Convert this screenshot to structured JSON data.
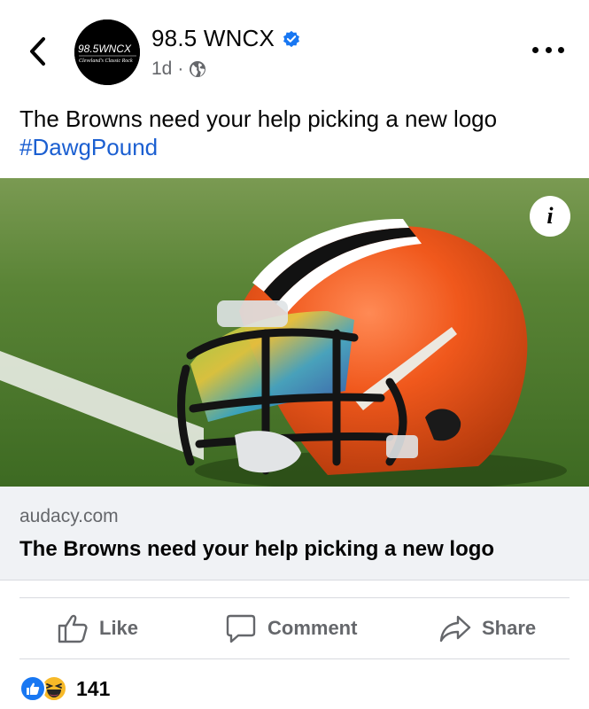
{
  "header": {
    "page_name": "98.5 WNCX",
    "time": "1d",
    "separator": "·",
    "avatar_line1": "98.5WNCX",
    "avatar_line2": "Cleveland's Classic Rock"
  },
  "post": {
    "text": "The Browns need your help picking a new logo",
    "hashtag": "#DawgPound"
  },
  "media": {
    "info_label": "i"
  },
  "link_card": {
    "domain": "audacy.com",
    "title": "The Browns need your help picking a new logo"
  },
  "actions": {
    "like": "Like",
    "comment": "Comment",
    "share": "Share"
  },
  "reactions": {
    "count": "141"
  },
  "colors": {
    "accent": "#1877f2",
    "hashtag": "#1b5fd1",
    "muted": "#65676b",
    "helmet_orange": "#f0581c",
    "grass": "#4e7a2e"
  }
}
